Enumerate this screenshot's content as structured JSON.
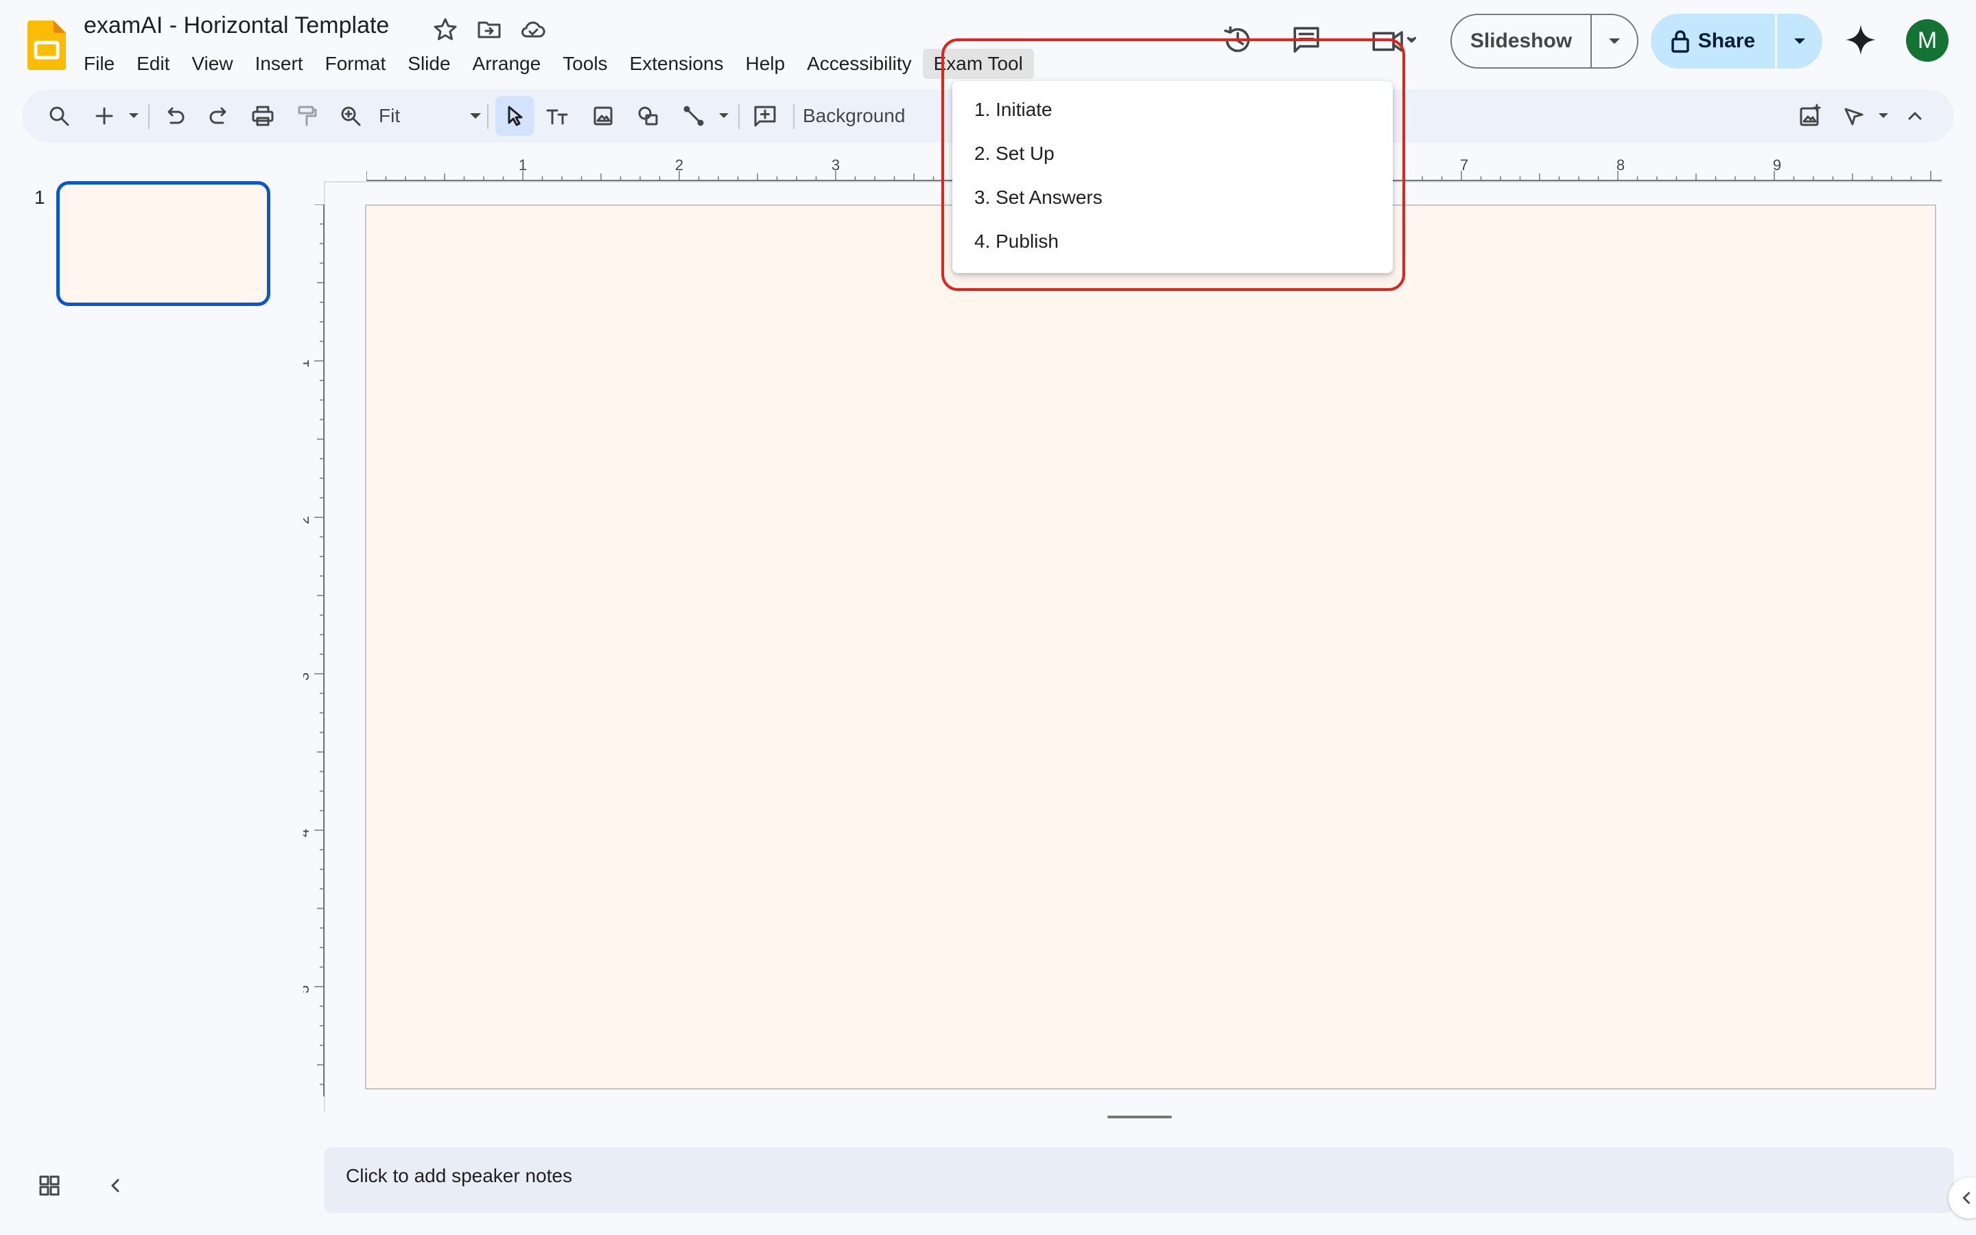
{
  "document": {
    "title": "examAI - Horizontal Template"
  },
  "menubar": {
    "items": [
      "File",
      "Edit",
      "View",
      "Insert",
      "Format",
      "Slide",
      "Arrange",
      "Tools",
      "Extensions",
      "Help",
      "Accessibility",
      "Exam Tool"
    ]
  },
  "header": {
    "slideshow_label": "Slideshow",
    "share_label": "Share",
    "avatar_initial": "M"
  },
  "toolbar": {
    "zoom_value": "Fit",
    "background_label": "Background"
  },
  "filmstrip": {
    "slides": [
      {
        "number": "1"
      }
    ]
  },
  "rulers": {
    "horizontal": [
      "1",
      "2",
      "3",
      "7",
      "8",
      "9"
    ],
    "vertical": [
      "1",
      "2",
      "3",
      "4",
      "5"
    ]
  },
  "exam_menu": {
    "items": [
      "1. Initiate",
      "2. Set Up",
      "3. Set Answers",
      "4. Publish"
    ]
  },
  "notes": {
    "placeholder": "Click to add speaker notes"
  },
  "colors": {
    "accent": "#0b57d0",
    "share_bg": "#c2e7ff",
    "slide_bg": "#fff6f0",
    "highlight": "#e2231a",
    "avatar_bg": "#137333"
  }
}
